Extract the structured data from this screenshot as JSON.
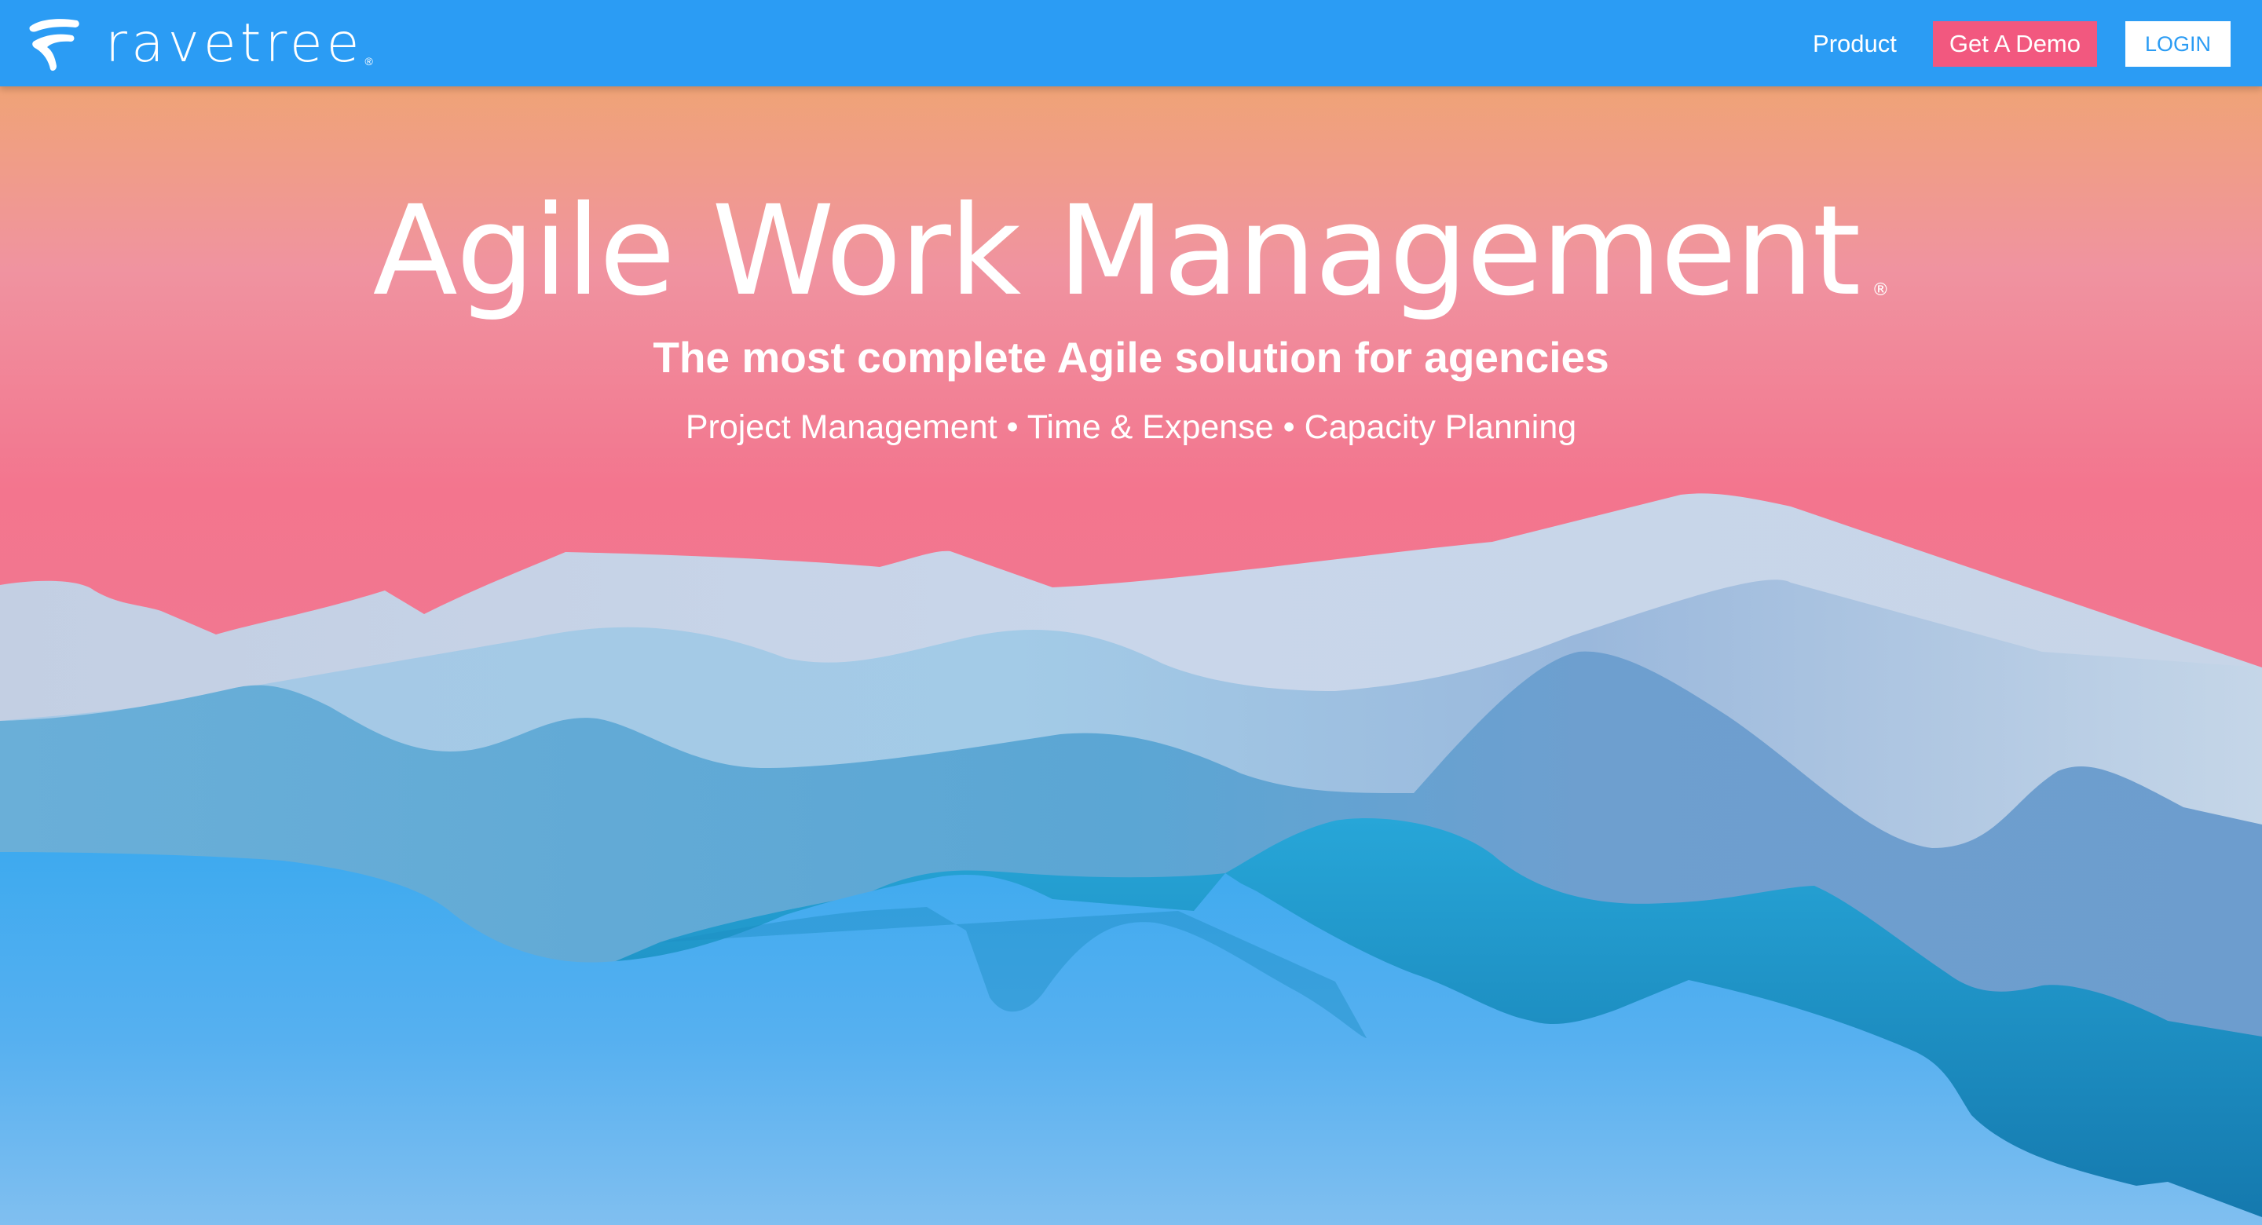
{
  "navbar": {
    "brand": "ravetree",
    "brand_mark": "®",
    "product_label": "Product",
    "demo_label": "Get A Demo",
    "login_label": "LOGIN"
  },
  "hero": {
    "title": "Agile Work Management",
    "title_mark": "®",
    "subtitle": "The most complete Agile solution for agencies",
    "features": "Project Management • Time & Expense • Capacity Planning"
  },
  "colors": {
    "navbar": "#2b9cf4",
    "demo_button": "#f2587f",
    "login_button": "#ffffff",
    "sky_top": "#efab63",
    "sky_bottom": "#f3758e"
  },
  "icons": {
    "logo": "ravetree-logo-icon"
  }
}
